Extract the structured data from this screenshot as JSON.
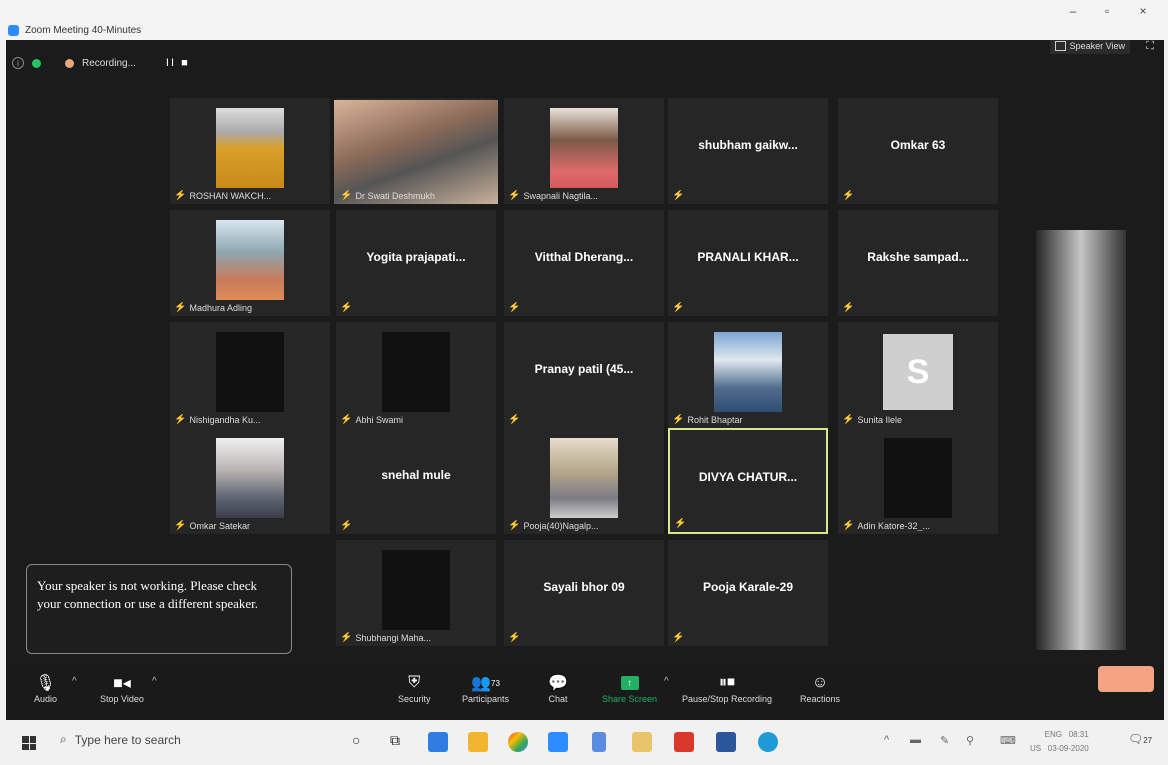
{
  "window": {
    "title": "Zoom Meeting 40-Minutes",
    "minimize": "–",
    "maximize": "▫",
    "close": "×"
  },
  "topbar": {
    "recording_label": "Recording...",
    "recording_controls": "II ■",
    "speaker_view_label": "Speaker View"
  },
  "participants": [
    {
      "label": "ROSHAN WAKCH...",
      "video": "p1"
    },
    {
      "label": "Dr Swati Deshmukh",
      "video": "p2"
    },
    {
      "label": "Swapnali Nagtila...",
      "video": "p3"
    },
    {
      "name": "shubham  gaikw..."
    },
    {
      "name": "Omkar 63"
    },
    {
      "label": "Madhura Adling",
      "video": "p4"
    },
    {
      "name": "Yogita  prajapati..."
    },
    {
      "name": "Vitthal  Dherang..."
    },
    {
      "name": "PRANALI KHAR..."
    },
    {
      "name": "Rakshe  sampad..."
    },
    {
      "label": "Nishigandha Ku...",
      "video": "dark"
    },
    {
      "label": "Abhi Swami",
      "video": "dark"
    },
    {
      "name": "Pranay patil  (45..."
    },
    {
      "label": "Rohit Bhaptar",
      "video": "p5"
    },
    {
      "label": "Sunita Ilele",
      "avatar_letter": "S"
    },
    {
      "label": "Omkar Satekar",
      "video": "p6"
    },
    {
      "name": "snehal mule"
    },
    {
      "label": "Pooja(40)Nagalp...",
      "video": "p7"
    },
    {
      "name": "DIVYA CHATUR...",
      "active": true
    },
    {
      "label": "Adin Katore-32_...",
      "video": "dark"
    },
    {
      "label": "Shubhangi Maha...",
      "video": "dark"
    },
    {
      "name": "Sayali bhor 09"
    },
    {
      "name": "Pooja Karale-29"
    }
  ],
  "notice": "Your speaker is not working. Please check your connection or use a different speaker.",
  "controls": {
    "audio": "Audio",
    "stop_video": "Stop Video",
    "security": "Security",
    "participants": "Participants",
    "participants_count": "73",
    "chat": "Chat",
    "share_screen": "Share Screen",
    "pause_stop_recording": "Pause/Stop Recording",
    "reactions": "Reactions"
  },
  "taskbar": {
    "search_placeholder": "Type here to search",
    "language": "ENG",
    "region": "US",
    "time": "08:31",
    "date": "03-09-2020",
    "notification_count": "27"
  },
  "colors": {
    "meeting_bg": "#1b1b1b",
    "tile_bg": "#262626",
    "active_border": "#dbe58a",
    "share_green": "#23b064",
    "end_button": "#f4a383"
  }
}
